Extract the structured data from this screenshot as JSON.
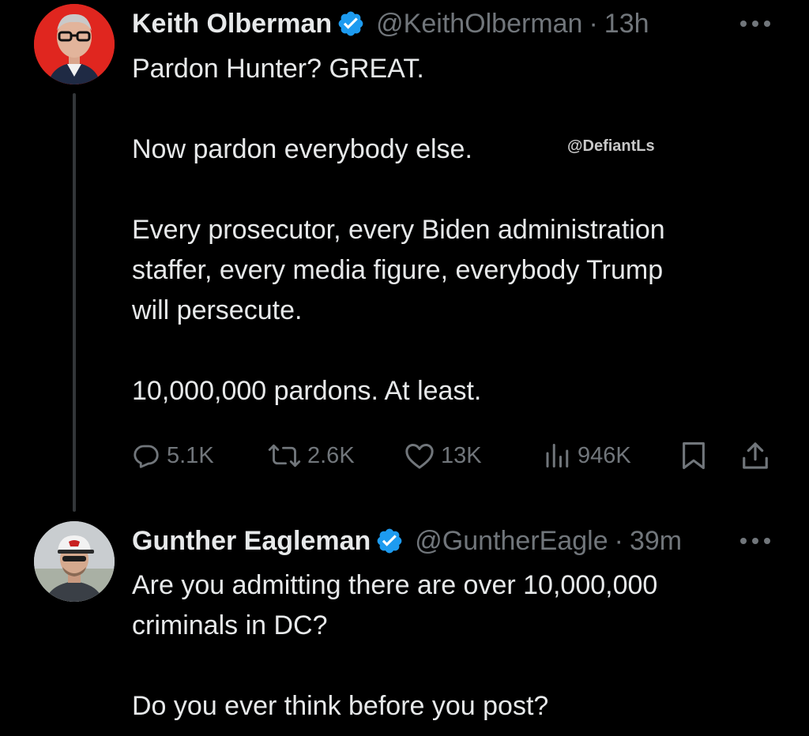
{
  "tweet": {
    "author_name": "Keith Olberman",
    "handle": "@KeithOlberman",
    "separator": "·",
    "time": "13h",
    "lines": [
      "Pardon Hunter? GREAT.",
      "",
      "Now pardon everybody else.",
      "",
      "Every prosecutor, every Biden administration",
      "staffer, every media figure, everybody Trump",
      "will persecute.",
      "",
      "10,000,000 pardons. At least."
    ],
    "watermark": "@DefiantLs",
    "stats": {
      "replies": "5.1K",
      "reposts": "2.6K",
      "likes": "13K",
      "views": "946K"
    }
  },
  "reply": {
    "author_name": "Gunther Eagleman",
    "handle": "@GuntherEagle",
    "separator": "·",
    "time": "39m",
    "lines": [
      "Are you admitting there are over 10,000,000",
      "criminals in DC?",
      "",
      "Do you ever think before you post?"
    ]
  },
  "icons": {
    "verified": "verified-badge-icon",
    "more": "more-dots-icon",
    "reply": "reply-bubble-icon",
    "repost": "repost-arrows-icon",
    "like": "heart-icon",
    "views": "views-chart-icon",
    "bookmark": "bookmark-icon",
    "share": "share-icon"
  },
  "colors": {
    "background": "#000000",
    "text": "#e7e9ea",
    "secondary": "#71767b",
    "verified": "#1d9bf0",
    "thread_line": "#333639"
  }
}
